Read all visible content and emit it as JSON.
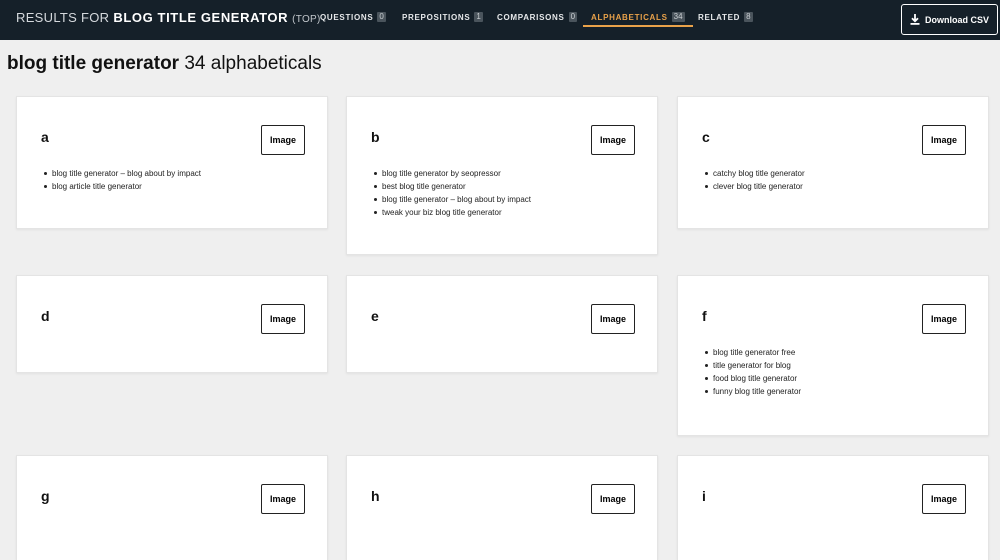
{
  "header": {
    "prefix": "RESULTS FOR",
    "keyword": "BLOG TITLE GENERATOR",
    "suffix": "(TOP)",
    "tabs": [
      {
        "label": "QUESTIONS",
        "count": "0"
      },
      {
        "label": "PREPOSITIONS",
        "count": "1"
      },
      {
        "label": "COMPARISONS",
        "count": "0"
      },
      {
        "label": "ALPHABETICALS",
        "count": "34",
        "active": true
      },
      {
        "label": "RELATED",
        "count": "8"
      }
    ],
    "download_label": "Download CSV",
    "accent_color": "#e9a24a",
    "bar_color": "#152029"
  },
  "page": {
    "keyword": "blog title generator",
    "count_text": "34 alphabeticals"
  },
  "cards": [
    {
      "letter": "a",
      "image_label": "Image",
      "items": [
        "blog title generator – blog about by impact",
        "blog article title generator"
      ]
    },
    {
      "letter": "b",
      "image_label": "Image",
      "items": [
        "blog title generator by seopressor",
        "best blog title generator",
        "blog title generator – blog about by impact",
        "tweak your biz blog title generator"
      ]
    },
    {
      "letter": "c",
      "image_label": "Image",
      "items": [
        "catchy blog title generator",
        "clever blog title generator"
      ]
    },
    {
      "letter": "d",
      "image_label": "Image",
      "items": []
    },
    {
      "letter": "e",
      "image_label": "Image",
      "items": []
    },
    {
      "letter": "f",
      "image_label": "Image",
      "items": [
        "blog title generator free",
        "title generator for blog",
        "food blog title generator",
        "funny blog title generator"
      ]
    },
    {
      "letter": "g",
      "image_label": "Image",
      "items": []
    },
    {
      "letter": "h",
      "image_label": "Image",
      "items": []
    },
    {
      "letter": "i",
      "image_label": "Image",
      "items": []
    }
  ]
}
